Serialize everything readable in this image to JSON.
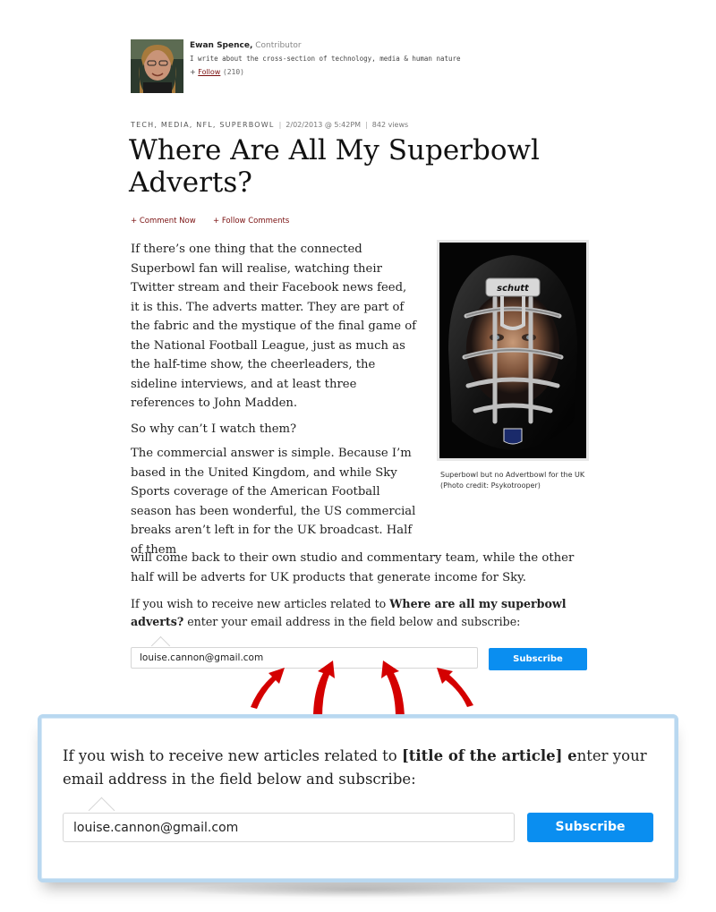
{
  "author": {
    "name": "Ewan Spence,",
    "role": "Contributor",
    "bio": "I write about the cross-section of technology, media & human nature",
    "follow_prefix": "+",
    "follow_label": "Follow",
    "follow_count": "(210)"
  },
  "article": {
    "tags": "TECH, MEDIA, NFL, SUPERBOWL",
    "date": "2/02/2013 @ 5:42PM",
    "views": "842 views",
    "title": "Where Are All My Superbowl Adverts?",
    "comment_now": "+ Comment Now",
    "follow_comments": "+ Follow Comments",
    "paragraphs": [
      "If there’s one thing that the connected Superbowl fan will realise, watching their Twitter stream and their Facebook news feed, it is this. The adverts matter. They are part of the fabric and the mystique of the final game of the National Football League, just as much as the half-time show, the cheerleaders, the sideline interviews, and at least three references to John Madden.",
      "So why can’t I watch them?",
      "The commercial answer is simple. Because I’m based in the United Kingdom, and while Sky Sports coverage of the American Football season has been wonderful, the US commercial breaks aren’t left in for the UK broadcast. Half of them",
      "will come back to their own studio and commentary team, while the other half will be adverts for UK products that generate income for Sky."
    ],
    "photo_caption": "Superbowl but no Advertbowl for the UK (Photo credit: Psykotrooper)",
    "helmet_brand": "schutt"
  },
  "subscribe": {
    "text_before": "If you wish to receive new articles related to ",
    "text_bold": "Where are all my superbowl adverts?",
    "text_after": " enter your email address in the field below and subscribe:",
    "email_value": "louise.cannon@gmail.com",
    "button_label": "Subscribe"
  },
  "callout": {
    "text_before": "If you wish to receive new articles related to ",
    "text_bold": "[title of the article] e",
    "text_after": "nter your email address in the field below and subscribe:",
    "email_value": "louise.cannon@gmail.com",
    "button_label": "Subscribe"
  },
  "colors": {
    "link": "#7a1010",
    "button": "#0a8ef0",
    "callout_border": "#b9d8f0",
    "arrow": "#d40000"
  }
}
